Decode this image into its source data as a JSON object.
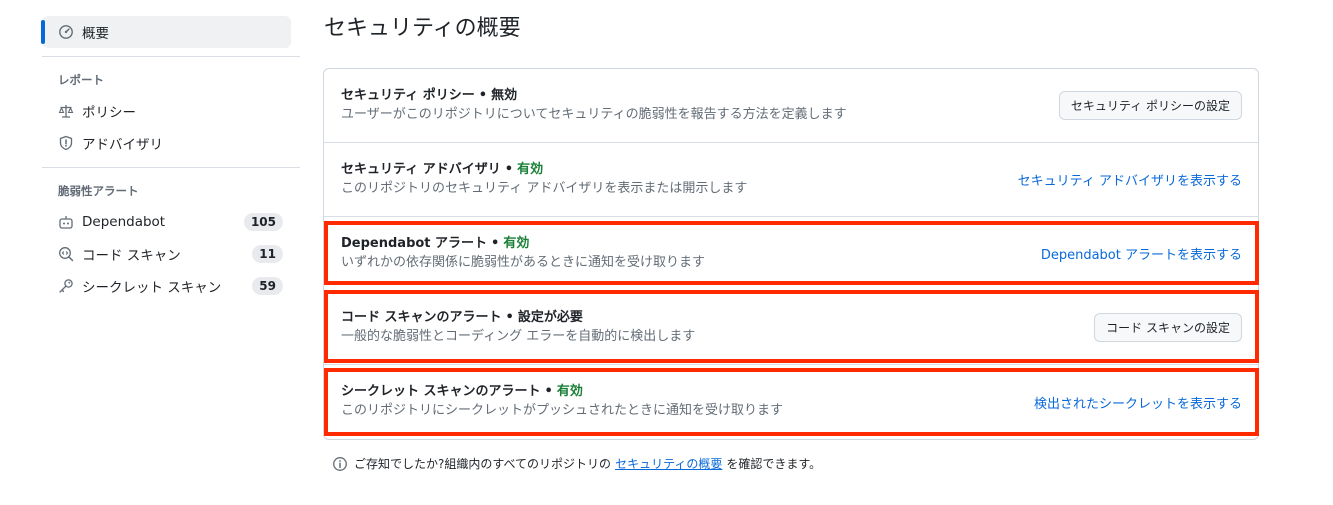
{
  "sidebar": {
    "active": {
      "label": "概要",
      "icon": "meter-icon"
    },
    "reports_title": "レポート",
    "reports": [
      {
        "label": "ポリシー",
        "icon": "law-icon"
      },
      {
        "label": "アドバイザリ",
        "icon": "shield-icon"
      }
    ],
    "alerts_title": "脆弱性アラート",
    "alerts": [
      {
        "label": "Dependabot",
        "count": "105",
        "icon": "dependabot-icon"
      },
      {
        "label": "コード スキャン",
        "count": "11",
        "icon": "codescan-icon"
      },
      {
        "label": "シークレット スキャン",
        "count": "59",
        "icon": "key-icon"
      }
    ]
  },
  "main": {
    "title": "セキュリティの概要",
    "rows": [
      {
        "title": "セキュリティ ポリシー",
        "status": "無効",
        "desc": "ユーザーがこのリポジトリについてセキュリティの脆弱性を報告する方法を定義します",
        "action": "セキュリティ ポリシーの設定",
        "action_type": "button"
      },
      {
        "title": "セキュリティ アドバイザリ",
        "status": "有効",
        "desc": "このリポジトリのセキュリティ アドバイザリを表示または開示します",
        "action": "セキュリティ アドバイザリを表示する",
        "action_type": "link"
      },
      {
        "title": "Dependabot アラート",
        "status": "有効",
        "desc": "いずれかの依存関係に脆弱性があるときに通知を受け取ります",
        "action": "Dependabot アラートを表示する",
        "action_type": "link"
      },
      {
        "title": "コード スキャンのアラート",
        "status": "設定が必要",
        "desc": "一般的な脆弱性とコーディング エラーを自動的に検出します",
        "action": "コード スキャンの設定",
        "action_type": "button"
      },
      {
        "title": "シークレット スキャンのアラート",
        "status": "有効",
        "desc": "このリポジトリにシークレットがプッシュされたときに通知を受け取ります",
        "action": "検出されたシークレットを表示する",
        "action_type": "link"
      }
    ],
    "footnote": {
      "before": "ご存知でしたか?組織内のすべてのリポジトリの",
      "link": "セキュリティの概要",
      "after": "を確認できます。"
    }
  },
  "colors": {
    "accent": "#0969da",
    "success": "#1a7f37",
    "highlight": "#ff2a00"
  }
}
